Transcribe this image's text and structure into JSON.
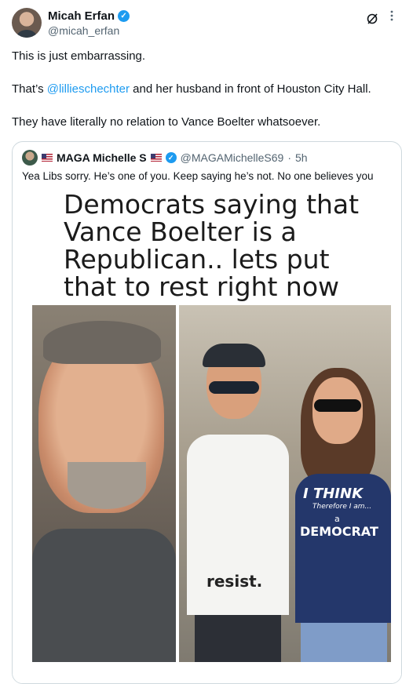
{
  "author": {
    "name": "Micah Erfan",
    "handle": "@micah_erfan",
    "verified_glyph": "✓",
    "avatar_icon": "user-avatar",
    "more_icon": "more-icon"
  },
  "post": {
    "line1": "This is just embarrassing.",
    "line2_prefix": "That’s ",
    "mention": "@lillieschechter",
    "line2_suffix": " and her husband in front of Houston City Hall.",
    "line3": "They have literally no relation to Vance Boelter whatsoever."
  },
  "quote": {
    "name": "MAGA Michelle S",
    "verified_glyph": "✓",
    "handle": "@MAGAMichelleS69",
    "separator": "·",
    "time": "5h",
    "text": "Yea Libs sorry.  He’s one of you. Keep saying he’s not. No one believes you",
    "image": {
      "title": "Democrats saying that\nVance Boelter is a\nRepublican.. lets put\nthat to rest right now",
      "shirt_man": "resist.",
      "shirt_woman_line1": "I THINK",
      "shirt_woman_line2": "Therefore I am...",
      "shirt_woman_line3": "a",
      "shirt_woman_line4": "DEMOCRAT"
    }
  },
  "colors": {
    "accent": "#1d9bf0",
    "text": "#0f1419",
    "muted": "#536471",
    "border": "#cfd9de"
  }
}
